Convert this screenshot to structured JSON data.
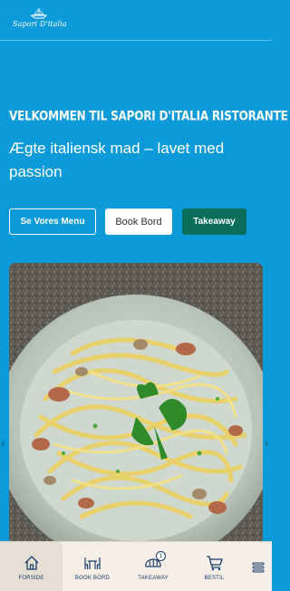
{
  "header": {
    "logo_text": "Sapori D'italia"
  },
  "hero": {
    "title": "VELKOMMEN TIL SAPORI D'ITALIA RISTORANTE",
    "subtitle": "Ægte italiensk mad – lavet med passion"
  },
  "buttons": {
    "menu": "Se Vores Menu",
    "book": "Book Bord",
    "takeaway": "Takeaway"
  },
  "carousel": {
    "prev_icon": "chevron-left-icon",
    "next_icon": "chevron-right-icon"
  },
  "bottom_nav": {
    "items": [
      {
        "label": "FORSIDE",
        "icon": "home-icon",
        "active": true
      },
      {
        "label": "BOOK BORD",
        "icon": "table-chairs-icon"
      },
      {
        "label": "TAKEAWAY",
        "icon": "bread-icon",
        "badge": "1"
      },
      {
        "label": "BESTIL",
        "icon": "cart-icon"
      }
    ],
    "more_icon": "menu-lines-icon"
  },
  "colors": {
    "background": "#0d9ad9",
    "takeaway_button": "#0a6e5a",
    "nav_background": "#f6efe7",
    "nav_text": "#1b3e6e"
  }
}
